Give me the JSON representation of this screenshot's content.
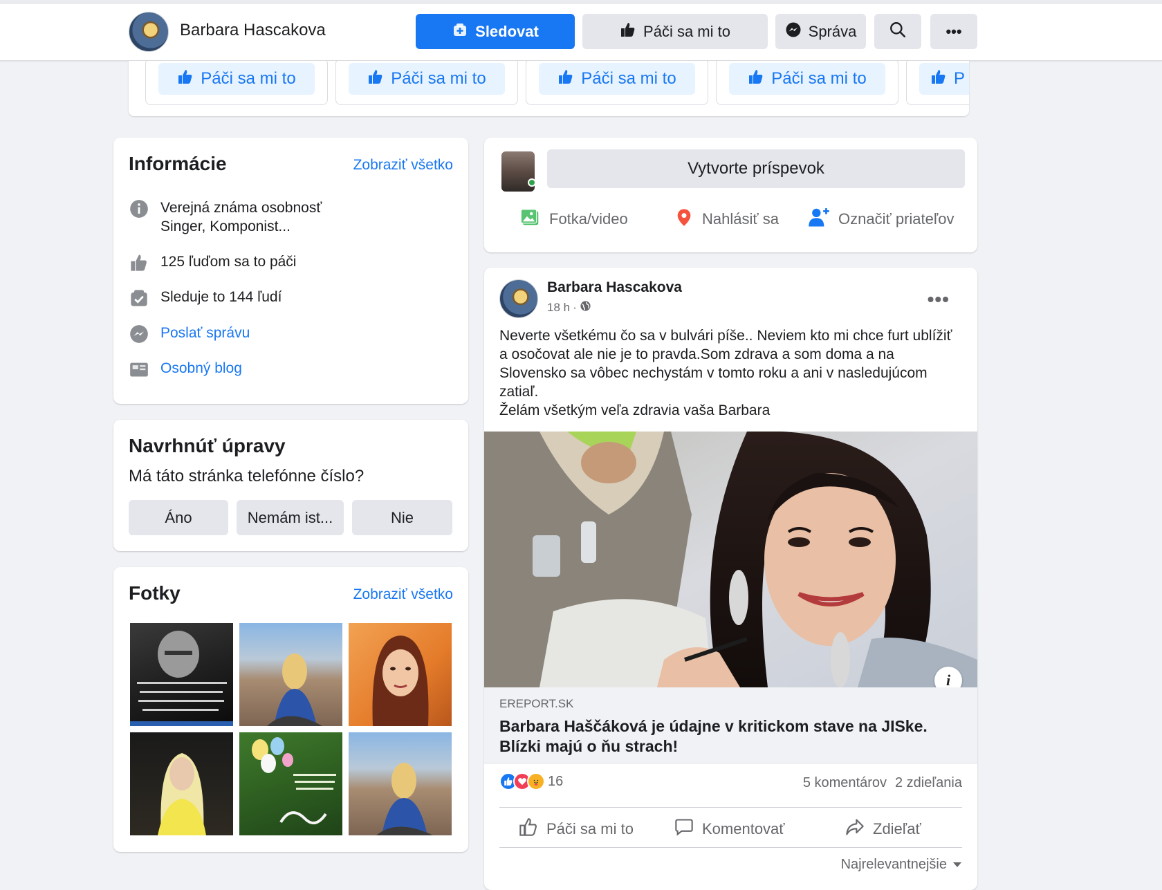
{
  "header": {
    "page_name": "Barbara Hascakova",
    "follow_label": "Sledovat",
    "like_label": "Páči sa mi to",
    "message_label": "Správa",
    "more_label": "•••"
  },
  "suggested_strip": {
    "like_labels": [
      "Páči sa mi to",
      "Páči sa mi to",
      "Páči sa mi to",
      "Páči sa mi to",
      "P"
    ]
  },
  "info": {
    "title": "Informácie",
    "see_all": "Zobraziť všetko",
    "category_line1": "Verejná známa osobnosť",
    "category_line2": "Singer, Komponist...",
    "likes": "125 ľuďom sa to páči",
    "followers": "Sleduje to 144 ľudí",
    "send_message": "Poslať správu",
    "blog": "Osobný blog"
  },
  "suggest_edits": {
    "title": "Navrhnúť úpravy",
    "question": "Má táto stránka telefónne číslo?",
    "yes": "Áno",
    "unsure": "Nemám ist...",
    "no": "Nie"
  },
  "photos": {
    "title": "Fotky",
    "see_all": "Zobraziť všetko"
  },
  "composer": {
    "placeholder": "Vytvorte príspevok",
    "photo_video": "Fotka/video",
    "check_in": "Nahlásiť sa",
    "tag_friends": "Označiť priateľov"
  },
  "post": {
    "author": "Barbara Hascakova",
    "time": "18 h",
    "dot_sep": "·",
    "text_line1": "Neverte všetkému čo sa v bulvári píše.. Neviem kto mi chce furt ublížiť a osočovat ale nie je to pravda.Som zdrava a som doma a na Slovensko sa vôbec nechystám v tomto roku a ani v nasledujúcom zatiaľ.",
    "text_line2": "Želám všetkým veľa zdravia vaša Barbara",
    "link_domain": "EREPORT.SK",
    "link_title": "Barbara Haščáková je údajne v kritickom stave na JISke. Blízki majú o ňu strach!",
    "reaction_count": "16",
    "comments": "5 komentárov",
    "shares": "2 zdieľania",
    "like_action": "Páči sa mi to",
    "comment_action": "Komentovať",
    "share_action": "Zdieľať",
    "sort_label": "Najrelevantnejšie"
  },
  "colors": {
    "brand": "#1877f2",
    "background": "#f0f2f5",
    "button_grey": "#e4e6eb",
    "secondary_text": "#65676b"
  }
}
